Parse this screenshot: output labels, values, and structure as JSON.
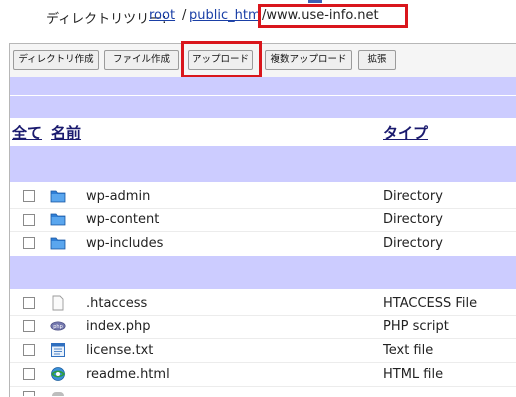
{
  "breadcrumb": {
    "label": "ディレクトリツリー:",
    "root": "root",
    "sep": "/",
    "public": "public_htm",
    "current": "/www.use-info.net"
  },
  "toolbar": {
    "buttons": [
      "ディレクトリ作成",
      "ファイル作成",
      "アップロード",
      "複数アップロード",
      "拡張"
    ]
  },
  "table": {
    "headers": {
      "select_all": "全て",
      "name": "名前",
      "type": "タイプ"
    },
    "directories": [
      {
        "name": "wp-admin",
        "type": "Directory",
        "icon": "folder-icon"
      },
      {
        "name": "wp-content",
        "type": "Directory",
        "icon": "folder-icon"
      },
      {
        "name": "wp-includes",
        "type": "Directory",
        "icon": "folder-icon"
      }
    ],
    "files": [
      {
        "name": ".htaccess",
        "type": "HTACCESS File",
        "icon": "blank-file-icon"
      },
      {
        "name": "index.php",
        "type": "PHP script",
        "icon": "php-icon"
      },
      {
        "name": "license.txt",
        "type": "Text file",
        "icon": "text-file-icon"
      },
      {
        "name": "readme.html",
        "type": "HTML file",
        "icon": "html-file-icon"
      }
    ]
  },
  "colors": {
    "highlight": "#d9161c",
    "band": "#ccccff",
    "link": "#1a3fa6"
  }
}
